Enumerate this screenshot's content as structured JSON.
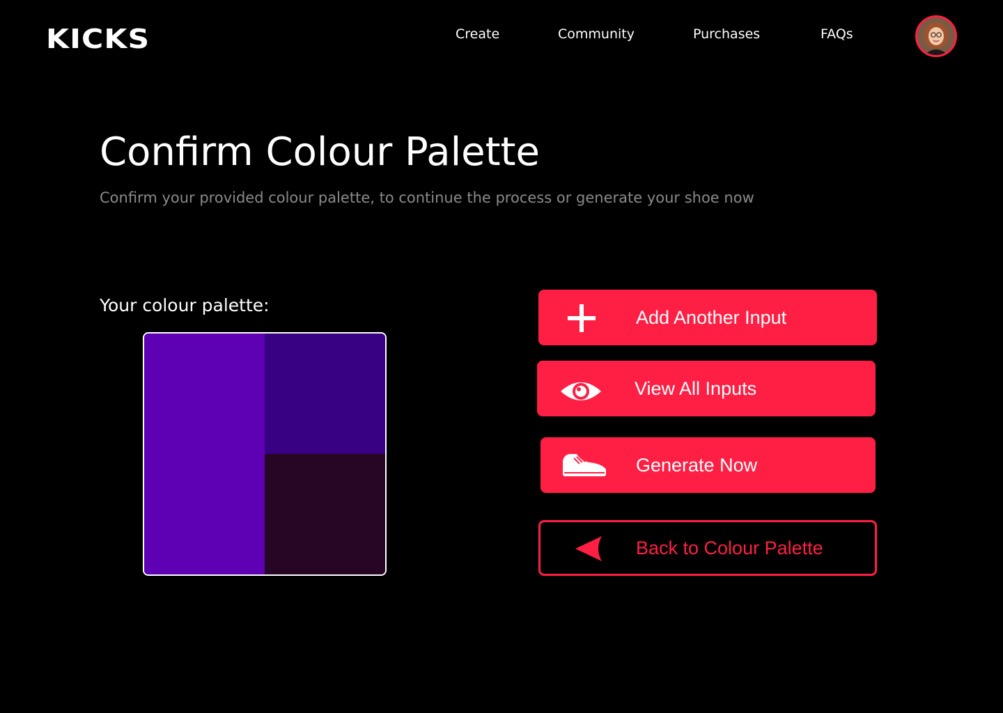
{
  "header": {
    "logo": "KICKS",
    "nav": [
      {
        "label": "Create"
      },
      {
        "label": "Community"
      },
      {
        "label": "Purchases"
      },
      {
        "label": "FAQs"
      }
    ],
    "avatar_icon": "user-avatar"
  },
  "main": {
    "title": "Confirm Colour Palette",
    "subtitle": "Confirm your provided colour palette, to continue the process or generate your shoe now",
    "palette_label": "Your colour palette:",
    "palette_colors": [
      "#5e00b3",
      "#380082",
      "#270524"
    ]
  },
  "actions": {
    "add_input": {
      "label": "Add Another Input",
      "icon": "plus-icon"
    },
    "view_inputs": {
      "label": "View All Inputs",
      "icon": "eye-icon"
    },
    "generate": {
      "label": "Generate Now",
      "icon": "sneaker-icon"
    },
    "back": {
      "label": "Back to Colour Palette",
      "icon": "arrow-left-icon"
    }
  },
  "colors": {
    "accent": "#ff1f44",
    "background": "#000000",
    "subtitle_text": "#8a8a8a"
  }
}
